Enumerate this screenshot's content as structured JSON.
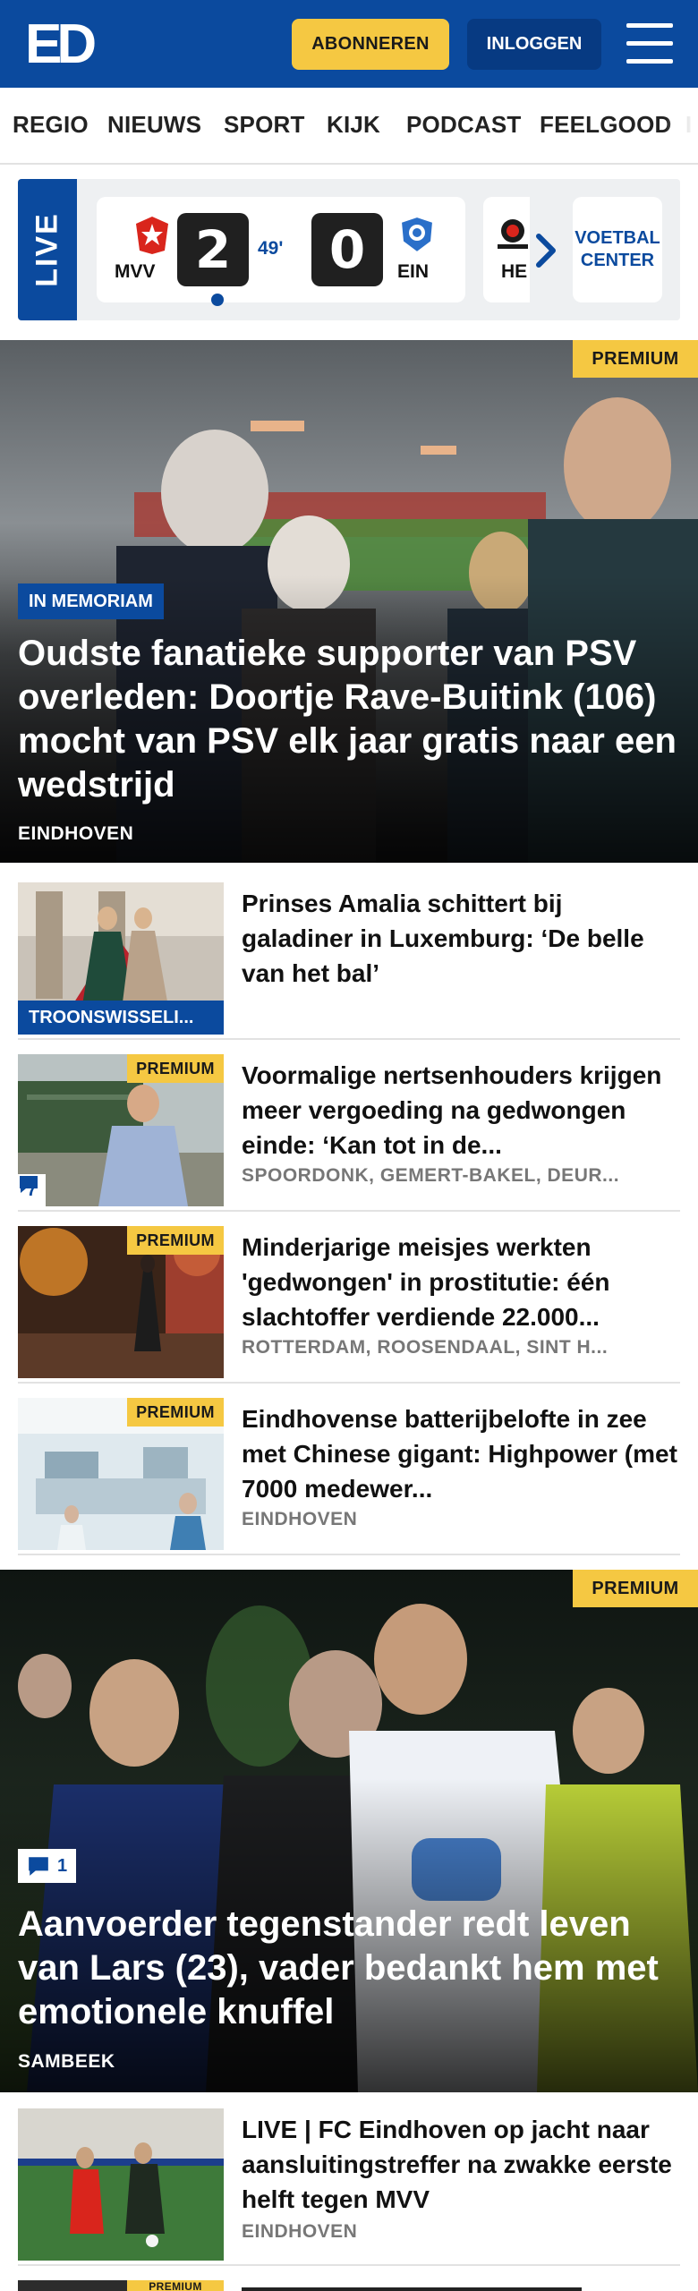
{
  "header": {
    "logo_text": "ED",
    "subscribe_label": "ABONNEREN",
    "login_label": "INLOGGEN",
    "brand_color": "#0b4a9e",
    "accent_color": "#f5c842"
  },
  "nav": {
    "items": [
      "REGIO",
      "NIEUWS",
      "SPORT",
      "KIJK",
      "PODCAST",
      "FEELGOOD"
    ]
  },
  "live": {
    "tag": "LIVE",
    "match": {
      "home_code": "MVV",
      "home_score": "2",
      "minute": "49'",
      "away_score": "0",
      "away_code": "EIN"
    },
    "next_match_code": "HE",
    "center_line1": "VOETBAL",
    "center_line2": "CENTER"
  },
  "hero1": {
    "premium": "PREMIUM",
    "kicker": "IN MEMORIAM",
    "title": "Oudste fanatieke supporter van PSV overleden: Doortje Rave-Buitink (106) mocht van PSV elk jaar gratis naar een wedstrijd",
    "location": "EINDHOVEN"
  },
  "articles": [
    {
      "kicker": "TROONSWISSELI...",
      "title": "Prinses Amalia schittert bij galadiner in Luxemburg: ‘De belle van het bal’"
    },
    {
      "premium": "PREMIUM",
      "comments": "7",
      "title": "Voormalige nertsenhouders krijgen meer vergoeding na gedwongen einde: ‘Kan tot in de...",
      "location": "SPOORDONK, GEMERT-BAKEL, DEUR..."
    },
    {
      "premium": "PREMIUM",
      "title": "Minderjarige meisjes werkten 'gedwongen' in prostitutie: één slachtoffer verdiende 22.000...",
      "location": "ROTTERDAM, ROOSENDAAL, SINT H..."
    },
    {
      "premium": "PREMIUM",
      "title": "Eindhovense batterijbelofte in zee met Chinese gigant: Highpower (met 7000 medewer...",
      "location": "EINDHOVEN"
    }
  ],
  "hero2": {
    "premium": "PREMIUM",
    "comments": "1",
    "title": "Aanvoerder tegenstander redt leven van Lars (23), vader bedankt hem met emotionele knuffel",
    "location": "SAMBEEK"
  },
  "article_last": {
    "title": "LIVE | FC Eindhoven op jacht naar aansluitingstreffer na zwakke eerste helft tegen MVV",
    "location": "EINDHOVEN"
  },
  "article_cut": {
    "premium": "PREMIUM"
  }
}
